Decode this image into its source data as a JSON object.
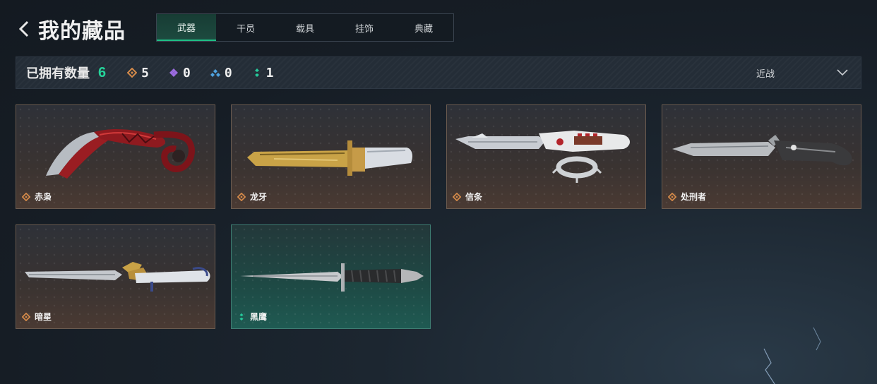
{
  "header": {
    "title": "我的藏品"
  },
  "tabs": [
    {
      "label": "武器",
      "active": true
    },
    {
      "label": "干员"
    },
    {
      "label": "载具"
    },
    {
      "label": "挂饰"
    },
    {
      "label": "典藏"
    }
  ],
  "stats": {
    "owned_label": "已拥有数量",
    "owned_count": "6",
    "rarities": [
      {
        "icon": "orange-diamond-icon",
        "color": "#d48a4a",
        "count": "5"
      },
      {
        "icon": "purple-diamond-icon",
        "color": "#9b6be0",
        "count": "0"
      },
      {
        "icon": "blue-diamond-icon",
        "color": "#4fa3e0",
        "count": "0"
      },
      {
        "icon": "green-rarity-icon",
        "color": "#26c99a",
        "count": "1"
      }
    ],
    "sort_label": "近战"
  },
  "items": [
    {
      "name": "赤枭",
      "rarity": "orange"
    },
    {
      "name": "龙牙",
      "rarity": "orange"
    },
    {
      "name": "信条",
      "rarity": "orange"
    },
    {
      "name": "处刑者",
      "rarity": "orange"
    },
    {
      "name": "暗星",
      "rarity": "orange"
    },
    {
      "name": "黑鹰",
      "rarity": "green"
    }
  ]
}
